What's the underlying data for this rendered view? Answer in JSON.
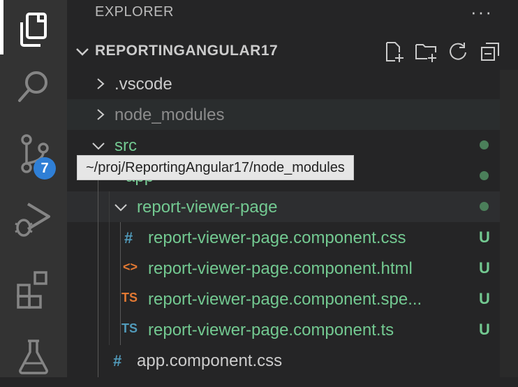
{
  "activity_bar": {
    "items": [
      {
        "name": "explorer-icon"
      },
      {
        "name": "search-icon"
      },
      {
        "name": "source-control-icon",
        "badge": "7"
      },
      {
        "name": "run-debug-icon"
      },
      {
        "name": "extensions-icon"
      },
      {
        "name": "testing-icon"
      }
    ]
  },
  "explorer": {
    "title": "EXPLORER",
    "more": "···",
    "section": {
      "label": "REPORTINGANGULAR17",
      "actions": [
        "new-file-icon",
        "new-folder-icon",
        "refresh-icon",
        "collapse-all-icon"
      ]
    },
    "tree": [
      {
        "label": ".vscode",
        "type": "folder",
        "expanded": false,
        "depth": 0
      },
      {
        "label": "node_modules",
        "type": "folder",
        "expanded": false,
        "depth": 0
      },
      {
        "label": "src",
        "type": "folder",
        "expanded": true,
        "depth": 0,
        "status": "dot"
      },
      {
        "label": "app",
        "type": "folder",
        "expanded": true,
        "depth": 1,
        "status": "dot"
      },
      {
        "label": "report-viewer-page",
        "type": "folder",
        "expanded": true,
        "depth": 2,
        "status": "dot"
      },
      {
        "label": "report-viewer-page.component.css",
        "icon": "#",
        "depth": 3,
        "status": "U"
      },
      {
        "label": "report-viewer-page.component.html",
        "icon": "<>",
        "depth": 3,
        "status": "U"
      },
      {
        "label": "report-viewer-page.component.spe...",
        "icon": "TS",
        "depth": 3,
        "status": "U"
      },
      {
        "label": "report-viewer-page.component.ts",
        "icon": "TS",
        "depth": 3,
        "status": "U"
      },
      {
        "label": "app.component.css",
        "icon": "#",
        "depth": 2
      }
    ],
    "tooltip": "~/proj/ReportingAngular17/node_modules"
  },
  "colors": {
    "modified_green": "#73c991",
    "css_icon": "#519aba",
    "html_icon": "#e37933",
    "spec_ts_icon": "#e37933",
    "ts_icon": "#519aba"
  }
}
